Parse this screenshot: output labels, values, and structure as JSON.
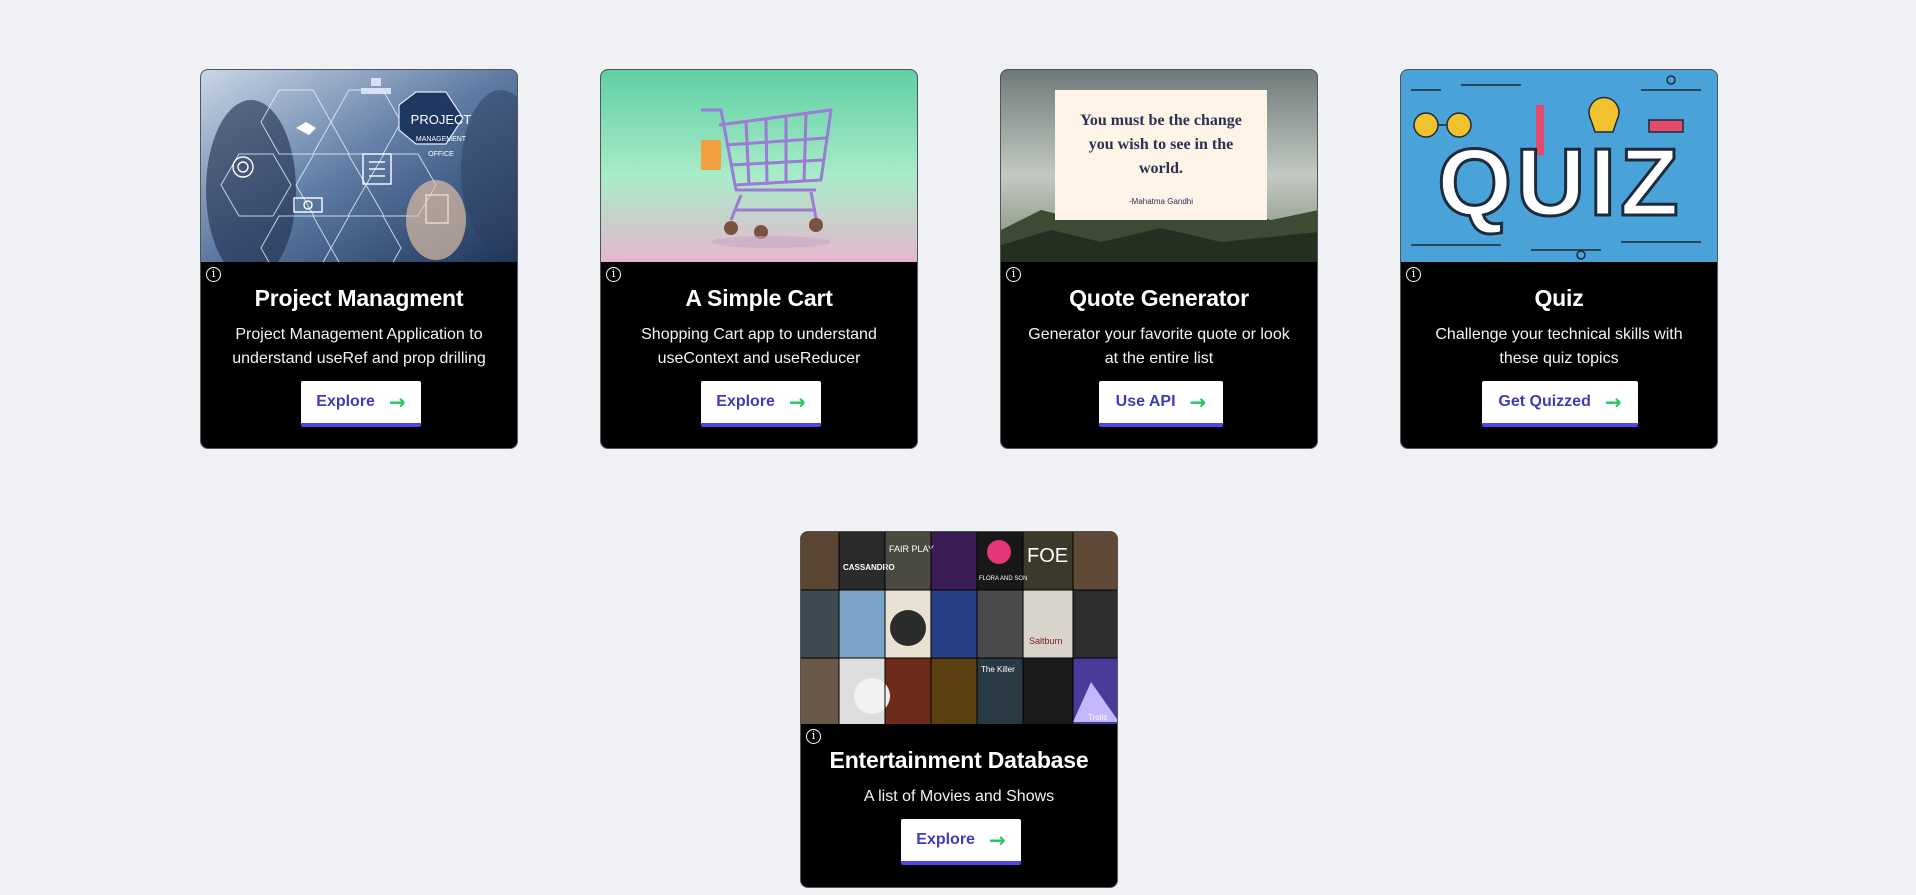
{
  "cards": [
    {
      "title": "Project Managment",
      "description": "Project Management Application to understand useRef and prop drilling",
      "button_label": "Explore",
      "image_icon": "project-management-office-image",
      "image_text": [
        "PROJECT",
        "MANAGEMENT",
        "OFFICE"
      ]
    },
    {
      "title": "A Simple Cart",
      "description": "Shopping Cart app to understand useContext and useReducer",
      "button_label": "Explore",
      "image_icon": "shopping-cart-image"
    },
    {
      "title": "Quote Generator",
      "description": "Generator your favorite quote or look at the entire list",
      "button_label": "Use API",
      "image_icon": "quote-card-image",
      "quote_text": [
        "You must be the change",
        "you wish to see in the",
        "world."
      ],
      "quote_author": "-Mahatma Gandhi"
    },
    {
      "title": "Quiz",
      "description": "Challenge your technical skills with these quiz topics",
      "button_label": "Get Quizzed",
      "image_icon": "quiz-doodle-image",
      "image_text": "QUIZ"
    },
    {
      "title": "Entertainment Database",
      "description": "A list of Movies and Shows",
      "button_label": "Explore",
      "image_icon": "movie-posters-collage-image",
      "poster_texts": [
        "CASSANDRO",
        "FAIR PLAY",
        "FOE",
        "FLORA AND SON",
        "Saltburn",
        "The Killer",
        "Trolls"
      ]
    }
  ],
  "icons": {
    "info": "info-icon",
    "arrow": "arrow-right-icon"
  },
  "colors": {
    "background": "#eff1f5",
    "card": "#000000",
    "button_text": "#3f3cbb",
    "button_underline": "#4f46e5",
    "arrow": "#22c55e"
  }
}
